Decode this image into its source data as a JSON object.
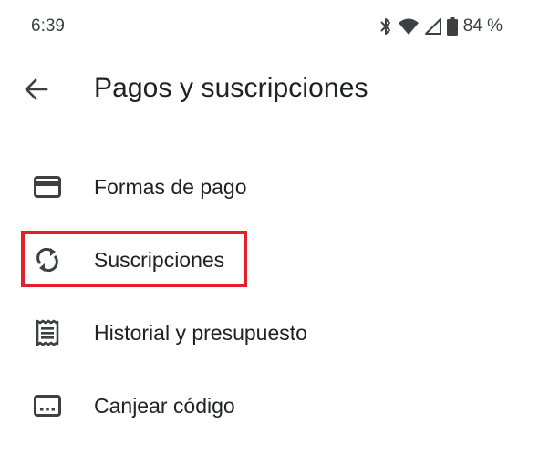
{
  "status_bar": {
    "time": "6:39",
    "battery": "84 %",
    "icons": [
      "bluetooth-icon",
      "wifi-icon",
      "signal-icon",
      "battery-icon"
    ]
  },
  "app_bar": {
    "title": "Pagos y suscripciones",
    "back_icon": "back-arrow-icon"
  },
  "menu": {
    "items": [
      {
        "label": "Formas de pago",
        "icon": "credit-card-icon"
      },
      {
        "label": "Suscripciones",
        "icon": "sync-icon",
        "highlighted": true
      },
      {
        "label": "Historial y presupuesto",
        "icon": "receipt-icon"
      },
      {
        "label": "Canjear código",
        "icon": "redeem-code-icon"
      }
    ]
  },
  "colors": {
    "text": "#202124",
    "icon": "#3c4043",
    "highlight": "#e0202a",
    "background": "#ffffff"
  }
}
